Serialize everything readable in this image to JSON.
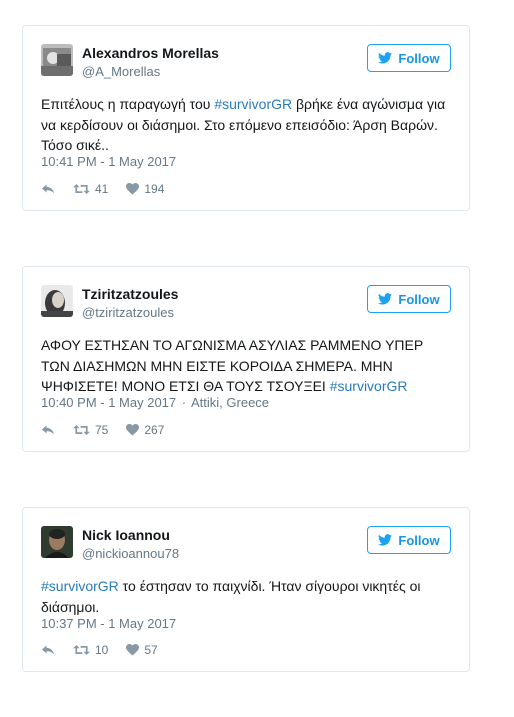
{
  "tweets": [
    {
      "name": "Alexandros Morellas",
      "handle": "@A_Morellas",
      "follow_label": "Follow",
      "text_before": "Επιτέλους η παραγωγή του ",
      "hashtag": "#survivorGR",
      "text_after": " βρήκε ένα αγώνισμα για να κερδίσουν οι διάσημοι. Στο επόμενο επεισόδιο: Άρση Βαρών. Τόσο σικέ..",
      "timestamp": "10:41 PM - 1 May 2017",
      "location": "",
      "retweets": "41",
      "likes": "194"
    },
    {
      "name": "Tziritzatzoules",
      "handle": "@tziritzatzoules",
      "follow_label": "Follow",
      "text_before": "ΑΦΟΥ ΕΣΤΗΣΑΝ ΤΟ ΑΓΩΝΙΣΜΑ ΑΣΥΛΙΑΣ ΡΑΜΜΕΝΟ ΥΠΕΡ ΤΩΝ ΔΙΑΣΗΜΩΝ ΜΗΝ ΕΙΣΤΕ ΚΟΡΟΙΔΑ ΣΗΜΕΡΑ. ΜΗΝ ΨΗΦΙΣΕΤΕ! ΜΟΝΟ ΕΤΣΙ ΘΑ ΤΟΥΣ ΤΣΟΥΞΕΙ ",
      "hashtag": "#survivorGR",
      "text_after": "",
      "timestamp": "10:40 PM - 1 May 2017",
      "location": "Attiki, Greece",
      "retweets": "75",
      "likes": "267"
    },
    {
      "name": "Nick Ioannou",
      "handle": "@nickioannou78",
      "follow_label": "Follow",
      "text_before": "",
      "hashtag": "#survivorGR",
      "text_after": " το έστησαν το παιχνίδι. Ήταν σίγουροι νικητές οι διάσημοι.",
      "timestamp": "10:37 PM - 1 May 2017",
      "location": "",
      "retweets": "10",
      "likes": "57"
    }
  ],
  "meta_separator": "·",
  "colors": {
    "brand_blue": "#1da1f2",
    "link": "#2b7bb9",
    "muted": "#657786",
    "border": "#e1e8ed"
  },
  "icons": [
    "twitter-bird-icon",
    "reply-icon",
    "retweet-icon",
    "heart-icon"
  ]
}
